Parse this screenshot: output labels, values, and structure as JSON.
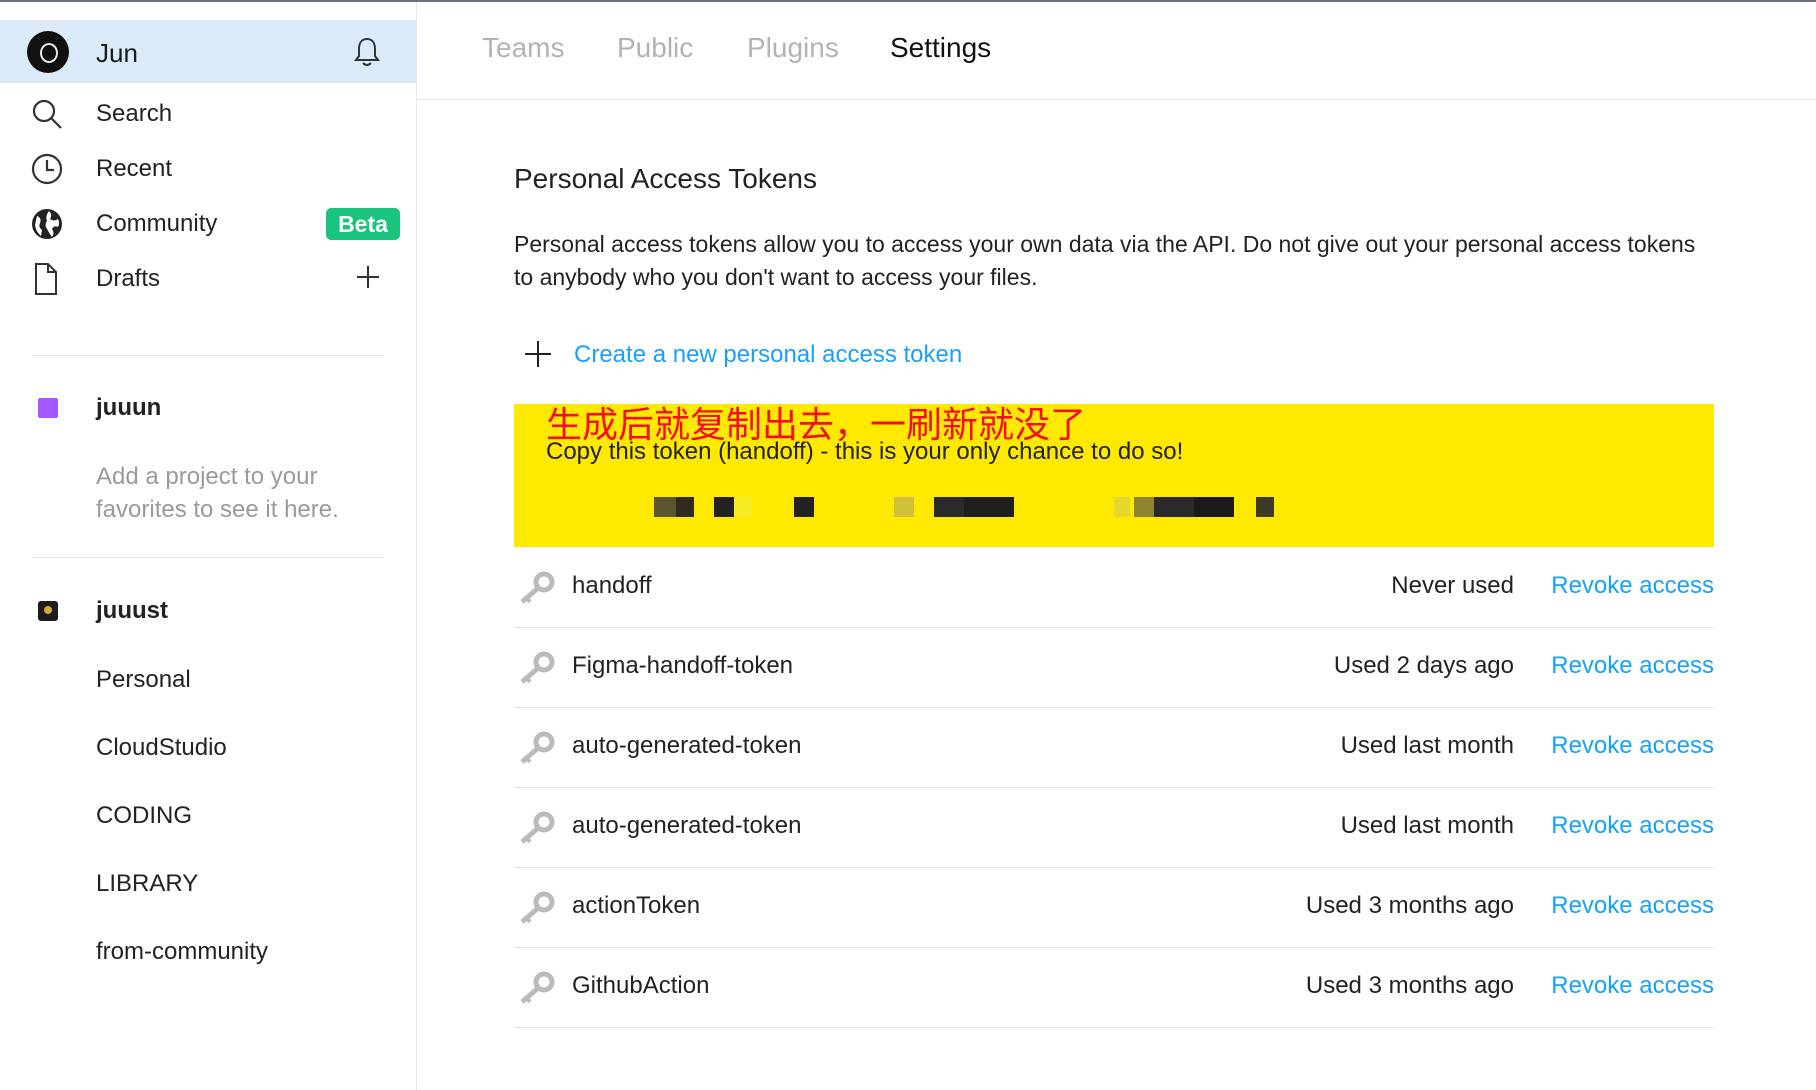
{
  "sidebar": {
    "user_name": "Jun",
    "nav": [
      {
        "label": "Search",
        "icon": "search-icon"
      },
      {
        "label": "Recent",
        "icon": "clock-icon"
      },
      {
        "label": "Community",
        "icon": "globe-icon",
        "badge": "Beta"
      },
      {
        "label": "Drafts",
        "icon": "file-icon"
      }
    ],
    "team1": {
      "name": "juuun",
      "hint": "Add a project to your favorites to see it here."
    },
    "team2": {
      "name": "juuust",
      "projects": [
        "Personal",
        "CloudStudio",
        "CODING",
        "LIBRARY",
        "from-community"
      ]
    }
  },
  "tabs": [
    "Teams",
    "Public",
    "Plugins",
    "Settings"
  ],
  "active_tab": "Settings",
  "section": {
    "title": "Personal Access Tokens",
    "description": "Personal access tokens allow you to access your own data via the API. Do not give out your personal access tokens to anybody who you don't want to access your files.",
    "create_label": "Create a new personal access token"
  },
  "annotation": {
    "chinese_note": "生成后就复制出去，一刷新就没了",
    "copy_note": "Copy this token (handoff) - this is your only chance to do so!"
  },
  "tokens": [
    {
      "name": "handoff",
      "used": "Never used",
      "action": "Revoke access"
    },
    {
      "name": "Figma-handoff-token",
      "used": "Used 2 days ago",
      "action": "Revoke access"
    },
    {
      "name": "auto-generated-token",
      "used": "Used last month",
      "action": "Revoke access"
    },
    {
      "name": "auto-generated-token",
      "used": "Used last month",
      "action": "Revoke access"
    },
    {
      "name": "actionToken",
      "used": "Used 3 months ago",
      "action": "Revoke access"
    },
    {
      "name": "GithubAction",
      "used": "Used 3 months ago",
      "action": "Revoke access"
    }
  ],
  "colors": {
    "accent": "#18a0fb",
    "beta": "#1bc47d",
    "highlight": "#ffe900",
    "annotation": "#f20f1f",
    "team": "#a259ff"
  }
}
